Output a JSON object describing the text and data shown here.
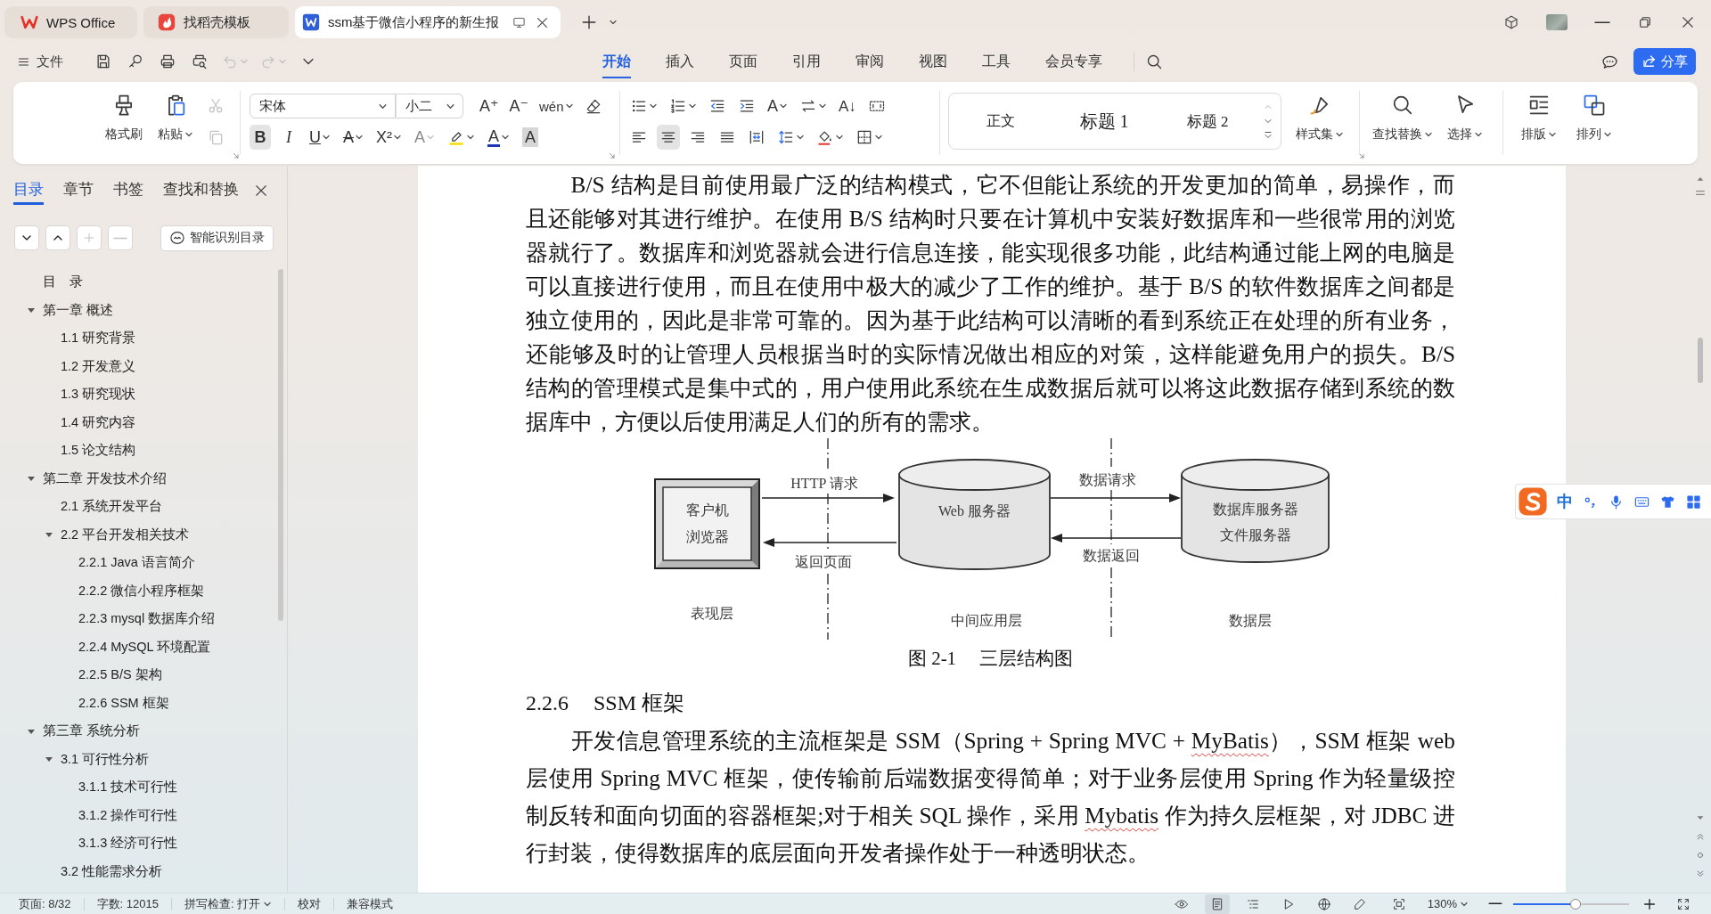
{
  "window": {
    "tabs": [
      {
        "label": "WPS Office",
        "kind": "wps",
        "selected": false
      },
      {
        "label": "找稻壳模板",
        "kind": "docer",
        "selected": false
      },
      {
        "label": "ssm基于微信小程序的新生报",
        "kind": "writer",
        "selected": true
      }
    ]
  },
  "menu": {
    "file": "文件",
    "quick_tools": [
      {
        "kind": "save",
        "dropdown": false,
        "disabled": false
      },
      {
        "kind": "export",
        "dropdown": false,
        "disabled": false
      },
      {
        "kind": "print",
        "dropdown": false,
        "disabled": false
      },
      {
        "kind": "preview",
        "dropdown": false,
        "disabled": false
      },
      {
        "kind": "undo",
        "dropdown": true,
        "disabled": true
      },
      {
        "kind": "redo",
        "dropdown": true,
        "disabled": true
      },
      {
        "kind": "more",
        "dropdown": false,
        "disabled": false
      }
    ],
    "tabs": [
      {
        "label": "开始",
        "selected": true
      },
      {
        "label": "插入",
        "selected": false
      },
      {
        "label": "页面",
        "selected": false
      },
      {
        "label": "引用",
        "selected": false
      },
      {
        "label": "审阅",
        "selected": false
      },
      {
        "label": "视图",
        "selected": false
      },
      {
        "label": "工具",
        "selected": false
      },
      {
        "label": "会员专享",
        "selected": false
      }
    ],
    "share": "分享"
  },
  "ribbon": {
    "clipboard": [
      {
        "kind": "format_painter",
        "label": "格式刷",
        "dropdown": false
      },
      {
        "kind": "paste",
        "label": "粘贴",
        "dropdown": true
      }
    ],
    "edit_tools": [
      {
        "kind": "cut",
        "disabled": true
      },
      {
        "kind": "copy",
        "disabled": true
      }
    ],
    "font_family": "宋体",
    "font_size": "小二",
    "font_tools": [
      {
        "kind": "grow",
        "glyph": "A⁺",
        "dropdown": false
      },
      {
        "kind": "shrink",
        "glyph": "A⁻",
        "dropdown": false
      },
      {
        "kind": "phonetic",
        "glyph": "wén",
        "dropdown": true
      },
      {
        "kind": "clear",
        "dropdown": false
      }
    ],
    "format_tools": [
      {
        "kind": "bold",
        "glyph": "B",
        "dropdown": false,
        "selected": true,
        "disabled": false
      },
      {
        "kind": "italic",
        "glyph": "I",
        "dropdown": false,
        "selected": false,
        "disabled": false
      },
      {
        "kind": "underline",
        "glyph": "U",
        "dropdown": true,
        "selected": false,
        "disabled": false
      },
      {
        "kind": "strikethrough",
        "glyph": "A",
        "dropdown": true,
        "selected": false,
        "disabled": false
      },
      {
        "kind": "superscript",
        "glyph": "X²",
        "dropdown": true,
        "selected": false,
        "disabled": false
      },
      {
        "kind": "text_effect",
        "glyph": "A",
        "dropdown": true,
        "selected": false,
        "disabled": true
      },
      {
        "kind": "highlight",
        "dropdown": true,
        "selected": false,
        "disabled": false
      },
      {
        "kind": "font_color",
        "glyph": "A",
        "dropdown": true,
        "selected": false,
        "disabled": false
      },
      {
        "kind": "char_shading",
        "glyph": "A",
        "dropdown": false,
        "selected": false,
        "disabled": false
      }
    ],
    "paragraph_tools": [
      {
        "kind": "bullets",
        "dropdown": true
      },
      {
        "kind": "numbering",
        "dropdown": true
      },
      {
        "kind": "outdent",
        "dropdown": false
      },
      {
        "kind": "indent",
        "dropdown": false
      },
      {
        "kind": "text_direction",
        "glyph": "A",
        "dropdown": true
      },
      {
        "kind": "swap",
        "dropdown": true
      },
      {
        "kind": "sort",
        "glyph": "A↓",
        "dropdown": false
      },
      {
        "kind": "dashed_box",
        "dropdown": false
      }
    ],
    "align_tools": [
      {
        "kind": "align_left",
        "dropdown": false,
        "selected": false
      },
      {
        "kind": "align_center",
        "dropdown": false,
        "selected": true
      },
      {
        "kind": "align_right",
        "dropdown": false,
        "selected": false
      },
      {
        "kind": "justify",
        "dropdown": false,
        "selected": false
      },
      {
        "kind": "distribute",
        "dropdown": false,
        "selected": false
      },
      {
        "kind": "line_spacing",
        "dropdown": true,
        "selected": false
      },
      {
        "kind": "shading",
        "dropdown": true,
        "selected": false
      },
      {
        "kind": "borders",
        "dropdown": true,
        "selected": false
      }
    ],
    "styles": [
      {
        "label": "正文",
        "kind": "body"
      },
      {
        "label": "标题 1",
        "kind": "heading1"
      },
      {
        "label": "标题 2",
        "kind": "heading2"
      }
    ],
    "style_tools": [
      {
        "kind": "style_set",
        "label": "样式集",
        "dropdown": true
      }
    ],
    "find_tools": [
      {
        "kind": "find",
        "label": "查找替换",
        "dropdown": true
      },
      {
        "kind": "select",
        "label": "选择",
        "dropdown": true
      }
    ],
    "arrange_tools": [
      {
        "kind": "layout",
        "label": "排版",
        "dropdown": true
      },
      {
        "kind": "arrange",
        "label": "排列",
        "dropdown": true
      }
    ]
  },
  "sidebar": {
    "tabs": [
      {
        "label": "目录",
        "selected": true
      },
      {
        "label": "章节",
        "selected": false
      },
      {
        "label": "书签",
        "selected": false
      },
      {
        "label": "查找和替换",
        "selected": false
      }
    ],
    "tools": [
      {
        "kind": "expand_down",
        "disabled": false
      },
      {
        "kind": "collapse_up",
        "disabled": false
      },
      {
        "kind": "add",
        "disabled": true
      },
      {
        "kind": "remove",
        "disabled": true
      }
    ],
    "smart_button": "智能识别目录",
    "toc": [
      {
        "label": "目　录"
      },
      {
        "label": "第一章 概述",
        "expanded": true,
        "children": [
          {
            "label": "1.1 研究背景"
          },
          {
            "label": "1.2 开发意义"
          },
          {
            "label": "1.3 研究现状"
          },
          {
            "label": "1.4 研究内容"
          },
          {
            "label": "1.5 论文结构"
          }
        ]
      },
      {
        "label": "第二章 开发技术介绍",
        "expanded": true,
        "children": [
          {
            "label": "2.1 系统开发平台"
          },
          {
            "label": "2.2 平台开发相关技术",
            "expanded": true,
            "children": [
              {
                "label": "2.2.1 Java 语言简介"
              },
              {
                "label": "2.2.2 微信小程序框架"
              },
              {
                "label": "2.2.3 mysql 数据库介绍"
              },
              {
                "label": "2.2.4 MySQL 环境配置"
              },
              {
                "label": "2.2.5 B/S 架构"
              },
              {
                "label": "2.2.6 SSM 框架"
              }
            ]
          }
        ]
      },
      {
        "label": "第三章 系统分析",
        "expanded": true,
        "children": [
          {
            "label": "3.1 可行性分析",
            "expanded": true,
            "children": [
              {
                "label": "3.1.1 技术可行性"
              },
              {
                "label": "3.1.2 操作可行性"
              },
              {
                "label": "3.1.3 经济可行性"
              }
            ]
          },
          {
            "label": "3.2 性能需求分析"
          }
        ]
      }
    ]
  },
  "document": {
    "blocks": [
      {
        "kind": "paragraph",
        "segments": [
          {
            "text": "B/S 结构是目前使用最广泛的结构模式，它不但能让系统的开发更加的简单，易操作，而且还能够对其进行维护。在使用 B/S 结构时只要在计算机中安装好数据库和一些很常用的浏览器就行了。数据库和浏览器就会进行信息连接，能实现很多功能，此结构通过能上网的电脑是可以直接进行使用，而且在使用中极大的减少了工作的维护。基于 B/S 的软件数据库之间都是独立使用的，因此是非常可靠的。因为基于此结构可以清晰的看到系统正在处理的所有业务，还能够及时的让管理人员根据当时的实际情况做出相应的对策，这样能避免用户的损失。B/S 结构的管理模式是集中式的，用户使用此系统在生成数据后就可以将这此数据存储到系统的数据库中，方便以后使用满足人们的所有的需求。",
            "misspelled": false
          }
        ]
      },
      {
        "kind": "figure",
        "client": [
          "客户机",
          "浏览器"
        ],
        "request": "HTTP 请求",
        "response": "返回页面",
        "web_server": "Web 服务器",
        "data_request": "数据请求",
        "data_response": "数据返回",
        "data_server": [
          "数据库服务器",
          "文件服务器"
        ],
        "layers": [
          "表现层",
          "中间应用层",
          "数据层"
        ]
      },
      {
        "kind": "caption",
        "number": "图 2-1",
        "title": "三层结构图"
      },
      {
        "kind": "heading",
        "number": "2.2.6",
        "title": "SSM 框架"
      },
      {
        "kind": "paragraph",
        "segments": [
          {
            "text": "开发信息管理系统的主流框架是 SSM（Spring + Spring MVC + ",
            "misspelled": false
          },
          {
            "text": "MyBatis",
            "misspelled": true
          },
          {
            "text": "），SSM 框架 web 层使用 Spring MVC 框架，使传输前后端数据变得简单；对于业务层使用 Spring 作为轻量级控制反转和面向切面的容器框架;对于相关 SQL 操作，采用 ",
            "misspelled": false
          },
          {
            "text": "Mybatis",
            "misspelled": true
          },
          {
            "text": " 作为持久层框架，对 JDBC 进行封装，使得数据库的底层面向开发者操作处于一种透明状态。",
            "misspelled": false
          }
        ]
      }
    ]
  },
  "ime": {
    "mode": "中"
  },
  "status_bar": {
    "page": "页面: 8/32",
    "words": "字数: 12015",
    "spell_check": "拼写检查: 打开",
    "proofread": "校对",
    "compat_mode": "兼容模式",
    "views": [
      {
        "kind": "reading",
        "selected": false
      },
      {
        "kind": "page",
        "selected": true
      },
      {
        "kind": "outline",
        "selected": false
      },
      {
        "kind": "slideshow",
        "selected": false
      },
      {
        "kind": "web",
        "selected": false
      },
      {
        "kind": "pen",
        "selected": false
      }
    ],
    "zoom": "130%",
    "zoom_slider": {
      "level": 0.54
    }
  }
}
